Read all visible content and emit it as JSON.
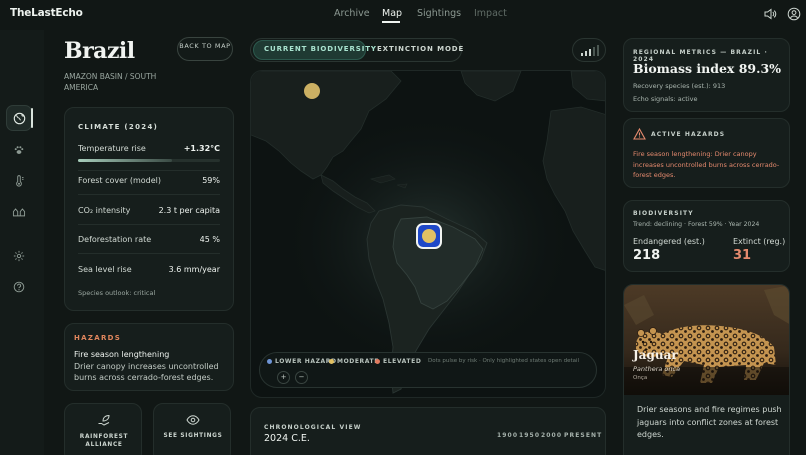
{
  "app": {
    "logo": "TheLastEcho"
  },
  "nav": {
    "items": [
      {
        "label": "Archive",
        "active": false
      },
      {
        "label": "Map",
        "active": true
      },
      {
        "label": "Sightings",
        "active": false
      },
      {
        "label": "Impact",
        "active": false
      }
    ],
    "icons": [
      "speaker-icon",
      "user-icon"
    ]
  },
  "rail": {
    "icons": [
      "globe-icon",
      "paw-icon",
      "thermometer-icon",
      "animals-icon",
      "settings-icon",
      "help-icon"
    ],
    "active": "globe-icon"
  },
  "country": {
    "name": "Brazil",
    "region": "AMAZON BASIN / SOUTH AMERICA",
    "back_label": "BACK TO MAP"
  },
  "climate": {
    "title": "CLIMATE (2024)",
    "rows": [
      {
        "label": "Temperature rise",
        "value": "+1.32°C"
      },
      {
        "label": "Forest cover (model)",
        "value": "59%"
      },
      {
        "label": "CO₂ intensity",
        "value": "2.3 t per capita"
      },
      {
        "label": "Deforestation rate",
        "value": "45 %"
      },
      {
        "label": "Sea level rise",
        "value": "3.6 mm/year"
      }
    ],
    "temperature_bar_fraction": 0.66,
    "outlook": "Species outlook: critical"
  },
  "hazards": {
    "title": "HAZARDS",
    "headline": "Fire season lengthening",
    "text": "Drier canopy increases uncontrolled burns across cerrado-forest edges."
  },
  "mini_cards": [
    {
      "label": "RAINFOREST ALLIANCE",
      "icon": "leaf-hand-icon"
    },
    {
      "label": "SEE SIGHTINGS",
      "icon": "eye-icon"
    }
  ],
  "map_controls": {
    "modes": [
      {
        "label": "CURRENT BIODIVERSITY",
        "active": true
      },
      {
        "label": "EXTINCTION MODE",
        "active": false
      }
    ],
    "signal_icon": "signal-icon"
  },
  "legend": {
    "items": [
      {
        "label": "LOWER HAZARD",
        "color": "#6f95d6"
      },
      {
        "label": "MODERATE",
        "color": "#e2c163"
      },
      {
        "label": "ELEVATED",
        "color": "#e07a5f"
      }
    ],
    "note": "Dots pulse by risk · Only highlighted states open detail",
    "zoom_in": "+",
    "zoom_out": "−"
  },
  "chronology": {
    "title": "CHRONOLOGICAL VIEW",
    "current": "2024 C.E.",
    "ticks": [
      "1900",
      "1950",
      "2000",
      "PRESENT"
    ]
  },
  "regional_metrics": {
    "title": "REGIONAL METRICS — BRAZIL · 2024",
    "headline": "Biomass index 89.3%",
    "recovery": "Recovery species (est.): 913",
    "signals": "Echo signals: active"
  },
  "active_hazards": {
    "title": "ACTIVE HAZARDS",
    "text": "Fire season lengthening: Drier canopy increases uncontrolled burns across cerrado-forest edges.",
    "icon": "warning-icon"
  },
  "biodiversity": {
    "title": "BIODIVERSITY",
    "trend": "Trend: declining · Forest 59% · Year 2024",
    "endangered_label": "Endangered (est.)",
    "endangered_value": "218",
    "extinct_label": "Extinct (reg.)",
    "extinct_value": "31",
    "extinct_color": "#e58a6e"
  },
  "species": {
    "name": "Jaguar",
    "latin": "Panthera onca",
    "local": "Onça",
    "text": "Drier seasons and fire regimes push jaguars into conflict zones at forest edges."
  }
}
